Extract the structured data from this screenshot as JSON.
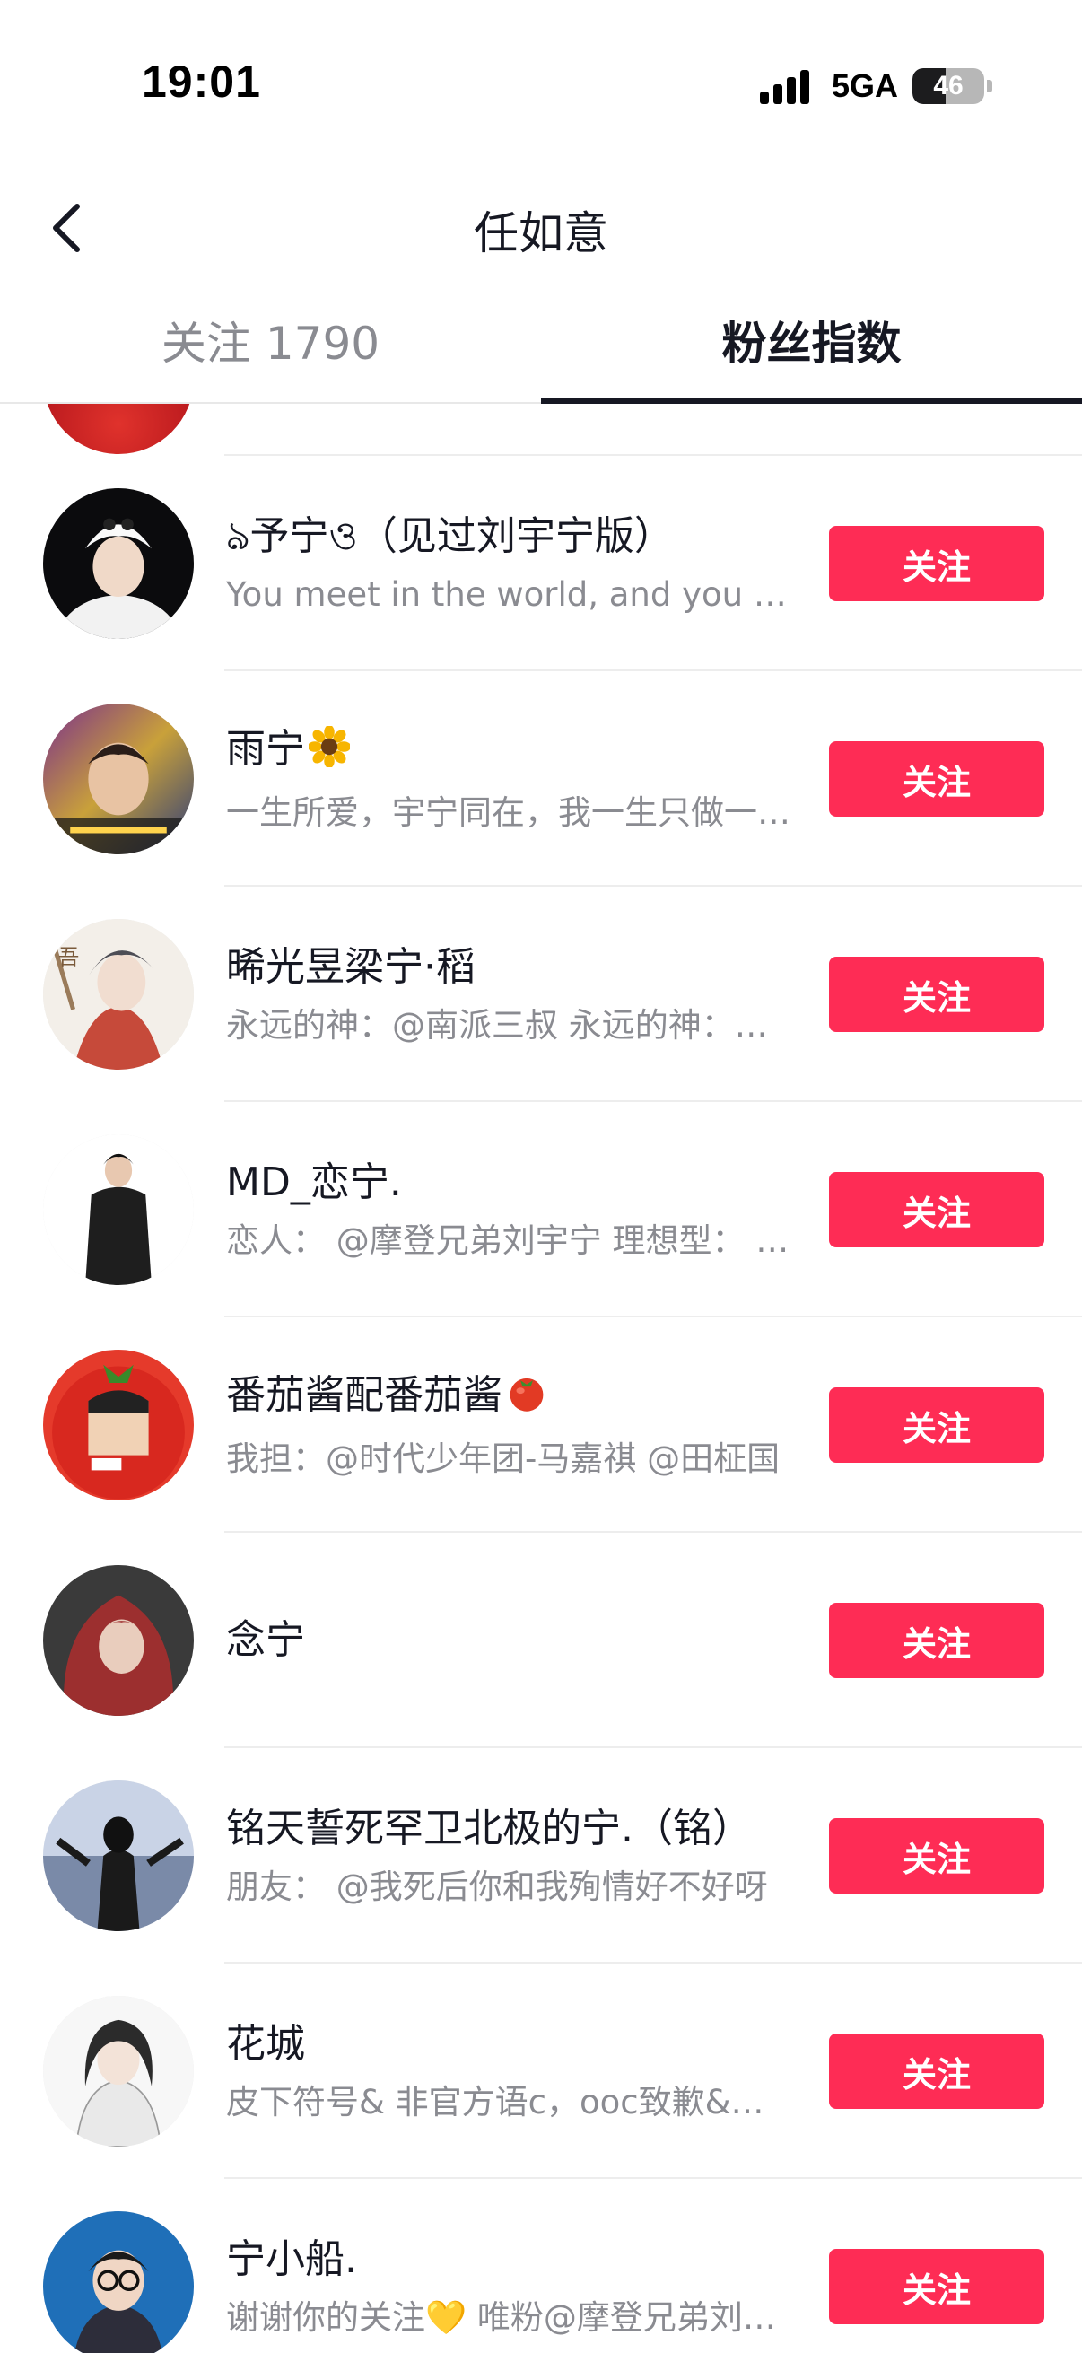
{
  "status_bar": {
    "time": "19:01",
    "network": "5GA",
    "battery_level": "46",
    "battery_fraction": 0.46
  },
  "header": {
    "title": "任如意",
    "back_icon": "chevron-left-icon"
  },
  "tabs": [
    {
      "label": "关注 1790",
      "active": false
    },
    {
      "label": "粉丝指数",
      "active": true
    }
  ],
  "follow_label": "关注",
  "users": [
    {
      "name": "ঌ予宁ও（见过刘宇宁版）",
      "bio": "You meet in the world, and you meet yourself",
      "emoji": ""
    },
    {
      "name": "雨宁",
      "bio": "一生所爱，宇宁同在，我一生只做一件事",
      "emoji": "sunflower-icon"
    },
    {
      "name": "晞光昱梁宁·稻",
      "bio": "永远的神：@南派三叔  永远的神：@刘宇宁",
      "emoji": ""
    },
    {
      "name": "MD_恋宁.",
      "bio": "恋人： @摩登兄弟刘宇宁  理想型： @刘宇宁",
      "emoji": ""
    },
    {
      "name": "番茄酱配番茄酱",
      "bio": "我担：@时代少年团-马嘉祺  @田柾国",
      "emoji": "tomato-icon"
    },
    {
      "name": "念宁",
      "bio": "",
      "emoji": ""
    },
    {
      "name": "铭天誓死罕卫北极的宁.（铭）",
      "bio": "朋友： @我死后你和我殉情好不好呀",
      "emoji": ""
    },
    {
      "name": "花城",
      "bio": "皮下符号& 非官方语c，ooc致歉&合作",
      "emoji": ""
    },
    {
      "name": "宁小船.",
      "bio": "谢谢你的关注💛 唯粉@摩登兄弟刘宇宁",
      "emoji": ""
    }
  ]
}
